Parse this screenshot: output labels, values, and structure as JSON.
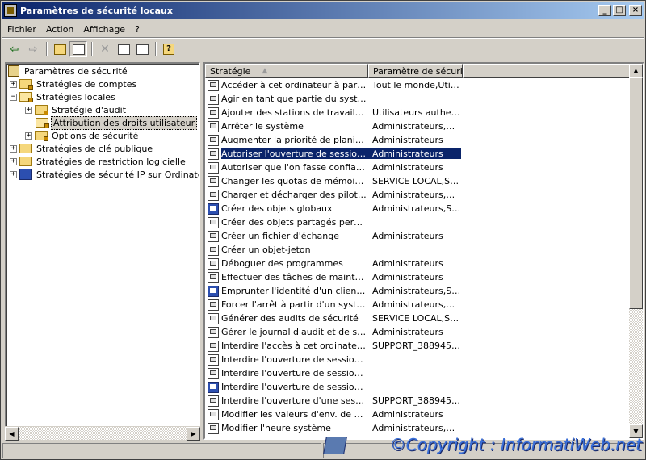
{
  "window": {
    "title": "Paramètres de sécurité locaux",
    "controls": {
      "minimize": "_",
      "maximize": "□",
      "close": "×"
    }
  },
  "menu": [
    {
      "label": "Fichier"
    },
    {
      "label": "Action"
    },
    {
      "label": "Affichage"
    },
    {
      "label": "?"
    }
  ],
  "toolbar": {
    "icons": [
      "back-icon",
      "forward-icon",
      "folder-up-icon",
      "show-hide-tree-icon",
      "delete-icon",
      "properties-icon",
      "export-list-icon",
      "help-icon"
    ]
  },
  "tree": {
    "root": "Paramètres de sécurité",
    "items": [
      {
        "label": "Stratégies de comptes",
        "expander": "+"
      },
      {
        "label": "Stratégies locales",
        "expander": "−"
      },
      {
        "label": "Stratégie d'audit",
        "expander": "+"
      },
      {
        "label": "Attribution des droits utilisateur",
        "selected": true
      },
      {
        "label": "Options de sécurité",
        "expander": "+"
      },
      {
        "label": "Stratégies de clé publique",
        "expander": "+"
      },
      {
        "label": "Stratégies de restriction logicielle",
        "expander": "+"
      },
      {
        "label": "Stratégies de sécurité IP sur Ordinateur local",
        "expander": "+"
      }
    ]
  },
  "list": {
    "columns": [
      "Stratégie",
      "Paramètre de sécurité"
    ],
    "sort_indicator": "▲",
    "rows": [
      {
        "policy": "Accéder à cet ordinateur à partir d...",
        "setting": "Tout le monde,Utilis..."
      },
      {
        "policy": "Agir en tant que partie du systèm...",
        "setting": ""
      },
      {
        "policy": "Ajouter des stations de travail au ...",
        "setting": "Utilisateurs authenti..."
      },
      {
        "policy": "Arrêter le système",
        "setting": "Administrateurs,Op..."
      },
      {
        "policy": "Augmenter la priorité de planification",
        "setting": "Administrateurs"
      },
      {
        "policy": "Autoriser l'ouverture de session p...",
        "setting": "Administrateurs",
        "selected": true
      },
      {
        "policy": "Autoriser que l'on fasse confiance ...",
        "setting": "Administrateurs"
      },
      {
        "policy": "Changer les quotas de mémoire d'...",
        "setting": "SERVICE LOCAL,SE..."
      },
      {
        "policy": "Charger et décharger des pilotes ...",
        "setting": "Administrateurs,Op..."
      },
      {
        "policy": "Créer des objets globaux",
        "setting": "Administrateurs,SE...",
        "alt_icon": true
      },
      {
        "policy": "Créer des objets partagés perman...",
        "setting": ""
      },
      {
        "policy": "Créer un fichier d'échange",
        "setting": "Administrateurs"
      },
      {
        "policy": "Créer un objet-jeton",
        "setting": ""
      },
      {
        "policy": "Déboguer des programmes",
        "setting": "Administrateurs"
      },
      {
        "policy": "Effectuer des tâches de maintena...",
        "setting": "Administrateurs"
      },
      {
        "policy": "Emprunter l'identité d'un client apr...",
        "setting": "Administrateurs,SE...",
        "alt_icon": true
      },
      {
        "policy": "Forcer l'arrêt à partir d'un système...",
        "setting": "Administrateurs,Op..."
      },
      {
        "policy": "Générer des audits de sécurité",
        "setting": "SERVICE LOCAL,SE..."
      },
      {
        "policy": "Gérer le journal d'audit et de sécurité",
        "setting": "Administrateurs"
      },
      {
        "policy": "Interdire l'accès à cet ordinateur à...",
        "setting": "SUPPORT_388945a0"
      },
      {
        "policy": "Interdire l'ouverture de session en...",
        "setting": ""
      },
      {
        "policy": "Interdire l'ouverture de session en...",
        "setting": ""
      },
      {
        "policy": "Interdire l'ouverture de session pa...",
        "setting": "",
        "alt_icon": true
      },
      {
        "policy": "Interdire l'ouverture d'une session...",
        "setting": "SUPPORT_388945a0"
      },
      {
        "policy": "Modifier les valeurs d'env. de micr...",
        "setting": "Administrateurs"
      },
      {
        "policy": "Modifier l'heure système",
        "setting": "Administrateurs,Op..."
      }
    ]
  },
  "watermark": "©Copyright : InformatiWeb.net"
}
